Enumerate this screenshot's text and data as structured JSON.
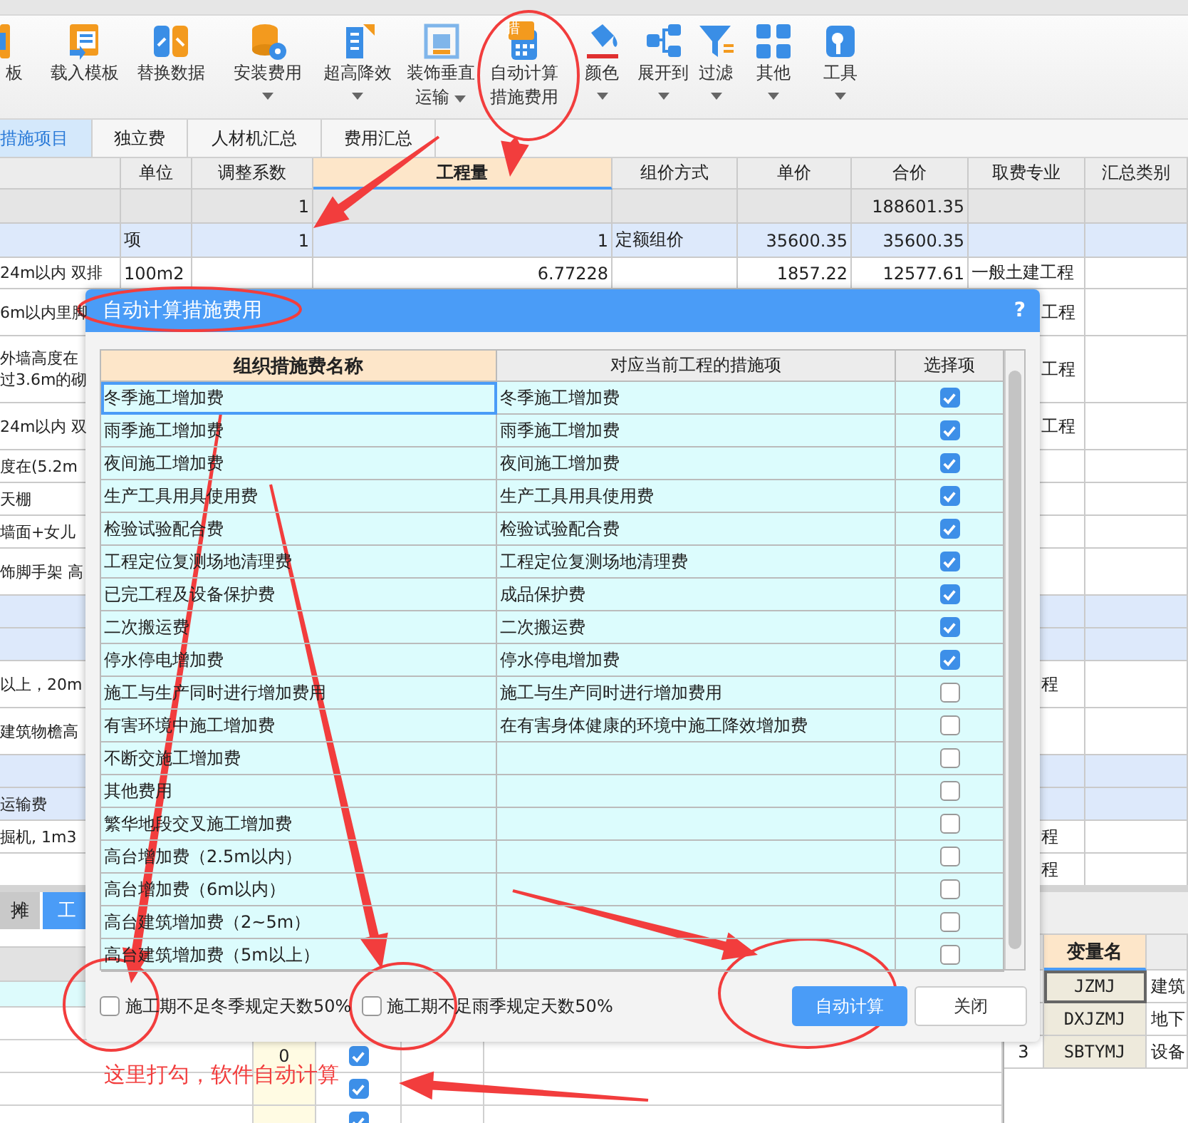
{
  "toolbar": {
    "items": [
      {
        "lines": [
          "板"
        ],
        "dropdown": false
      },
      {
        "lines": [
          "载入模板"
        ],
        "dropdown": false
      },
      {
        "lines": [
          "替换数据"
        ],
        "dropdown": false
      },
      {
        "lines": [
          "安装费用"
        ],
        "dropdown": true
      },
      {
        "lines": [
          "超高降效"
        ],
        "dropdown": true
      },
      {
        "lines": [
          "装饰垂直",
          "运输"
        ],
        "dropdown": true
      },
      {
        "lines": [
          "自动计算",
          "措施费用"
        ],
        "dropdown": false,
        "badge": "措"
      },
      {
        "lines": [
          "颜色"
        ],
        "dropdown": true
      },
      {
        "lines": [
          "展开到"
        ],
        "dropdown": true
      },
      {
        "lines": [
          "过滤"
        ],
        "dropdown": true
      },
      {
        "lines": [
          "其他"
        ],
        "dropdown": true
      },
      {
        "lines": [
          "工具"
        ],
        "dropdown": true
      }
    ]
  },
  "tabs": [
    {
      "label": "措施项目",
      "selected": true
    },
    {
      "label": "独立费",
      "selected": false
    },
    {
      "label": "人材机汇总",
      "selected": false
    },
    {
      "label": "费用汇总",
      "selected": false
    }
  ],
  "table": {
    "columns": [
      {
        "label": "单位",
        "selected": false
      },
      {
        "label": "调整系数",
        "selected": false
      },
      {
        "label": "工程量",
        "selected": true
      },
      {
        "label": "组价方式",
        "selected": false
      },
      {
        "label": "单价",
        "selected": false
      },
      {
        "label": "合价",
        "selected": false
      },
      {
        "label": "取费专业",
        "selected": false
      },
      {
        "label": "汇总类别",
        "selected": false
      }
    ],
    "rows": [
      {
        "kind": "total",
        "factor": "1",
        "total": "188601.35"
      },
      {
        "kind": "group",
        "unit": "项",
        "factor": "1",
        "quantity": "1",
        "method": "定额组价",
        "unit_price": "35600.35",
        "total": "35600.35"
      },
      {
        "kind": "item",
        "item": "24m以内 双排",
        "unit": "100m2",
        "quantity": "6.77228",
        "unit_price": "1857.22",
        "total": "12577.61",
        "specialty": "一般土建工程"
      },
      {
        "kind": "item",
        "item": "6m以内里脚",
        "specialty": "工程"
      },
      {
        "kind": "item",
        "item": "外墙高度在",
        "item_2": "过3.6m的砌",
        "specialty": "工程"
      },
      {
        "kind": "item",
        "item": "24m以内 双",
        "specialty": "工程"
      },
      {
        "kind": "item",
        "item": "度在(5.2m"
      },
      {
        "kind": "item",
        "item": "天棚"
      },
      {
        "kind": "item",
        "item": "墙面+女儿"
      },
      {
        "kind": "item",
        "item": "饰脚手架 高"
      },
      {
        "kind": "group"
      },
      {
        "kind": "group"
      },
      {
        "kind": "item",
        "item": "以上，20m",
        "specialty": "程"
      },
      {
        "kind": "item",
        "item": "建筑物檐高"
      },
      {
        "kind": "group"
      },
      {
        "kind": "group",
        "item": "运输费"
      },
      {
        "kind": "item",
        "item": "掘机, 1m3",
        "specialty": "程"
      },
      {
        "kind": "item",
        "specialty": "程"
      }
    ]
  },
  "bottom_panel": {
    "tabs": [
      {
        "label": "摊",
        "selected": false
      },
      {
        "label": "工",
        "selected": true
      }
    ],
    "rows": [
      {
        "value": "0",
        "checked": true
      },
      {
        "checked": true
      },
      {
        "checked": true
      }
    ]
  },
  "variables": {
    "header": "变量名",
    "rows": [
      {
        "name": "JZMJ",
        "description": "建筑",
        "selected": true
      },
      {
        "name": "DXJZMJ",
        "description": "地下",
        "selected": false
      },
      {
        "number": "3",
        "name": "SBTYMJ",
        "description": "设备",
        "selected": false
      }
    ]
  },
  "dialog": {
    "title": "自动计算措施费用",
    "help": "?",
    "columns": [
      "组织措施费名称",
      "对应当前工程的措施项",
      "选择项"
    ],
    "rows": [
      {
        "name": "冬季施工增加费",
        "match": "冬季施工增加费",
        "checked": true,
        "selected": true
      },
      {
        "name": "雨季施工增加费",
        "match": "雨季施工增加费",
        "checked": true,
        "selected": false
      },
      {
        "name": "夜间施工增加费",
        "match": "夜间施工增加费",
        "checked": true,
        "selected": false
      },
      {
        "name": "生产工具用具使用费",
        "match": "生产工具用具使用费",
        "checked": true,
        "selected": false
      },
      {
        "name": "检验试验配合费",
        "match": "检验试验配合费",
        "checked": true,
        "selected": false
      },
      {
        "name": "工程定位复测场地清理费",
        "match": "工程定位复测场地清理费",
        "checked": true,
        "selected": false
      },
      {
        "name": "已完工程及设备保护费",
        "match": "成品保护费",
        "checked": true,
        "selected": false
      },
      {
        "name": "二次搬运费",
        "match": "二次搬运费",
        "checked": true,
        "selected": false
      },
      {
        "name": "停水停电增加费",
        "match": "停水停电增加费",
        "checked": true,
        "selected": false
      },
      {
        "name": "施工与生产同时进行增加费用",
        "match": "施工与生产同时进行增加费用",
        "checked": false,
        "selected": false
      },
      {
        "name": "有害环境中施工增加费",
        "match": "在有害身体健康的环境中施工降效增加费",
        "checked": false,
        "selected": false
      },
      {
        "name": "不断交施工增加费",
        "checked": false,
        "selected": false
      },
      {
        "name": "其他费用",
        "checked": false,
        "selected": false
      },
      {
        "name": "繁华地段交叉施工增加费",
        "checked": false,
        "selected": false
      },
      {
        "name": "高台增加费（2.5m以内）",
        "checked": false,
        "selected": false
      },
      {
        "name": "高台增加费（6m以内）",
        "checked": false,
        "selected": false
      },
      {
        "name": "高台建筑增加费（2~5m）",
        "checked": false,
        "selected": false
      },
      {
        "name": "高台建筑增加费（5m以上）",
        "checked": false,
        "selected": false
      }
    ],
    "options": [
      {
        "label": "施工期不足冬季规定天数50%",
        "checked": false
      },
      {
        "label": "施工期不足雨季规定天数50%",
        "checked": false
      }
    ],
    "buttons": [
      {
        "label": "自动计算",
        "kind": "primary"
      },
      {
        "label": "关闭",
        "kind": "secondary"
      }
    ]
  },
  "annotation": {
    "note": "这里打勾，软件自动计算"
  }
}
